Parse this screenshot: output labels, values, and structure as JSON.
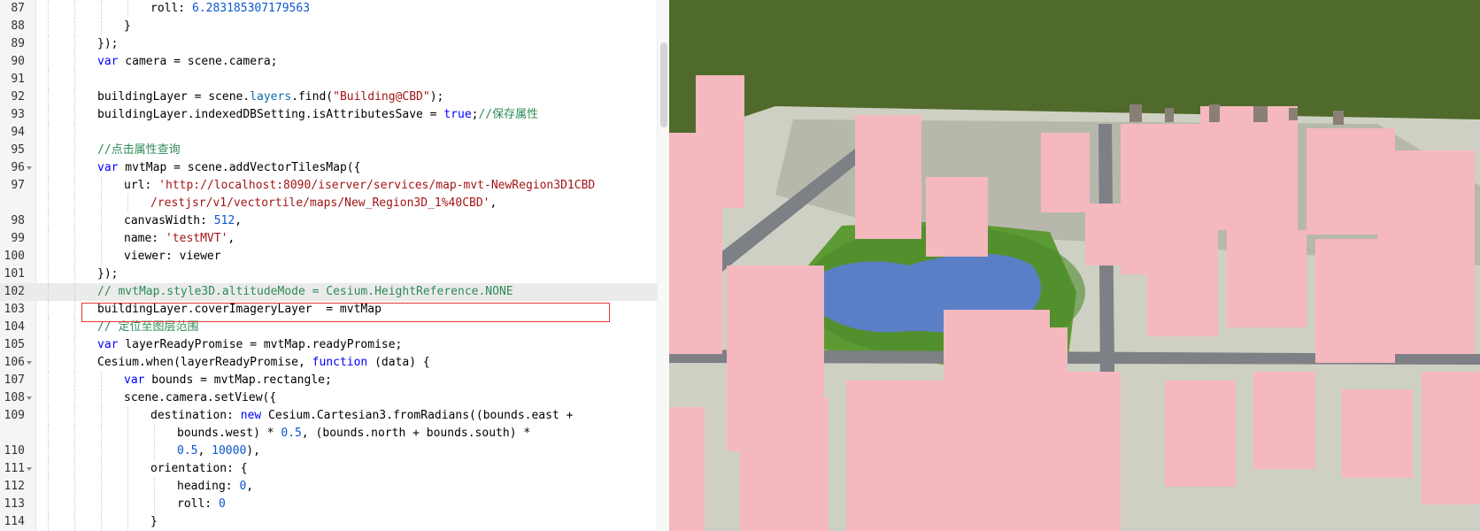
{
  "editor": {
    "lines": [
      {
        "n": "87",
        "indent": 5,
        "tokens": [
          [
            "roll: ",
            ""
          ],
          [
            "6.283185307179563",
            "num"
          ]
        ]
      },
      {
        "n": "88",
        "indent": 4,
        "tokens": [
          [
            "}",
            ""
          ]
        ]
      },
      {
        "n": "89",
        "indent": 3,
        "tokens": [
          [
            "});",
            ""
          ]
        ]
      },
      {
        "n": "90",
        "indent": 3,
        "tokens": [
          [
            "var",
            "kw"
          ],
          [
            " camera = scene.camera;",
            ""
          ]
        ]
      },
      {
        "n": "91",
        "indent": 3,
        "tokens": []
      },
      {
        "n": "92",
        "indent": 3,
        "tokens": [
          [
            "buildingLayer = scene.",
            ""
          ],
          [
            "layers",
            "prop"
          ],
          [
            ".find(",
            ""
          ],
          [
            "\"Building@CBD\"",
            "str"
          ],
          [
            ");",
            ""
          ]
        ]
      },
      {
        "n": "93",
        "indent": 3,
        "tokens": [
          [
            "buildingLayer.indexedDBSetting.isAttributesSave = ",
            ""
          ],
          [
            "true",
            "kw"
          ],
          [
            ";",
            ""
          ],
          [
            "//保存属性",
            "cm"
          ]
        ]
      },
      {
        "n": "94",
        "indent": 3,
        "tokens": []
      },
      {
        "n": "95",
        "indent": 3,
        "tokens": [
          [
            "//点击属性查询",
            "cm"
          ]
        ]
      },
      {
        "n": "96",
        "indent": 3,
        "fold": true,
        "tokens": [
          [
            "var",
            "kw"
          ],
          [
            " mvtMap = scene.addVectorTilesMap({",
            ""
          ]
        ]
      },
      {
        "n": "97",
        "indent": 4,
        "tokens": [
          [
            "url: ",
            ""
          ],
          [
            "'http://localhost:8090/iserver/services/map-mvt-NewRegion3D1CBD",
            "str"
          ]
        ]
      },
      {
        "n": "",
        "indent": 5,
        "tokens": [
          [
            "/restjsr/v1/vectortile/maps/New_Region3D_1%40CBD'",
            "str"
          ],
          [
            ",",
            ""
          ]
        ]
      },
      {
        "n": "98",
        "indent": 4,
        "tokens": [
          [
            "canvasWidth: ",
            ""
          ],
          [
            "512",
            "num"
          ],
          [
            ",",
            ""
          ]
        ]
      },
      {
        "n": "99",
        "indent": 4,
        "tokens": [
          [
            "name: ",
            ""
          ],
          [
            "'testMVT'",
            "str"
          ],
          [
            ",",
            ""
          ]
        ]
      },
      {
        "n": "100",
        "indent": 4,
        "tokens": [
          [
            "viewer: viewer",
            ""
          ]
        ]
      },
      {
        "n": "101",
        "indent": 3,
        "tokens": [
          [
            "});",
            ""
          ]
        ]
      },
      {
        "n": "102",
        "indent": 3,
        "active": true,
        "tokens": [
          [
            "// mvtMap.style3D.altitudeMode = Cesium.HeightReference.NONE",
            "cm"
          ]
        ]
      },
      {
        "n": "103",
        "indent": 3,
        "tokens": [
          [
            "buildingLayer.coverImageryLayer  = mvtMap",
            ""
          ]
        ]
      },
      {
        "n": "104",
        "indent": 3,
        "tokens": [
          [
            "// 定位至图层范围",
            "cm"
          ]
        ]
      },
      {
        "n": "105",
        "indent": 3,
        "tokens": [
          [
            "var",
            "kw"
          ],
          [
            " layerReadyPromise = mvtMap.readyPromise;",
            ""
          ]
        ]
      },
      {
        "n": "106",
        "indent": 3,
        "fold": true,
        "tokens": [
          [
            "Cesium.when(layerReadyPromise, ",
            ""
          ],
          [
            "function",
            "kw"
          ],
          [
            " (data) {",
            ""
          ]
        ]
      },
      {
        "n": "107",
        "indent": 4,
        "tokens": [
          [
            "var",
            "kw"
          ],
          [
            " bounds = mvtMap.rectangle;",
            ""
          ]
        ]
      },
      {
        "n": "108",
        "indent": 4,
        "fold": true,
        "tokens": [
          [
            "scene.camera.setView({",
            ""
          ]
        ]
      },
      {
        "n": "109",
        "indent": 5,
        "tokens": [
          [
            "destination: ",
            ""
          ],
          [
            "new",
            "kw"
          ],
          [
            " Cesium.Cartesian3.fromRadians((bounds.east +",
            ""
          ]
        ]
      },
      {
        "n": "",
        "indent": 6,
        "tokens": [
          [
            "bounds.west) * ",
            ""
          ],
          [
            "0.5",
            "num"
          ],
          [
            ", (bounds.north + bounds.south) *",
            ""
          ]
        ]
      },
      {
        "n": "110",
        "indent": 6,
        "tokens": [
          [
            "0.5",
            "num"
          ],
          [
            ", ",
            ""
          ],
          [
            "10000",
            "num"
          ],
          [
            "),",
            ""
          ]
        ]
      },
      {
        "n": "111",
        "indent": 5,
        "fold": true,
        "tokens": [
          [
            "orientation: {",
            ""
          ]
        ]
      },
      {
        "n": "112",
        "indent": 6,
        "tokens": [
          [
            "heading: ",
            ""
          ],
          [
            "0",
            "num"
          ],
          [
            ",",
            ""
          ]
        ]
      },
      {
        "n": "113",
        "indent": 6,
        "tokens": [
          [
            "roll: ",
            ""
          ],
          [
            "0",
            "num"
          ]
        ]
      },
      {
        "n": "114",
        "indent": 5,
        "tokens": [
          [
            "}",
            ""
          ]
        ]
      }
    ]
  },
  "scene": {
    "sky_color": "#4f6a2a",
    "ground_color": "#cfd0c4",
    "building_color": "#f4b8be",
    "water_color": "#5a7fc6",
    "park_color": "#5c9a34",
    "road_color": "#7d8084"
  }
}
